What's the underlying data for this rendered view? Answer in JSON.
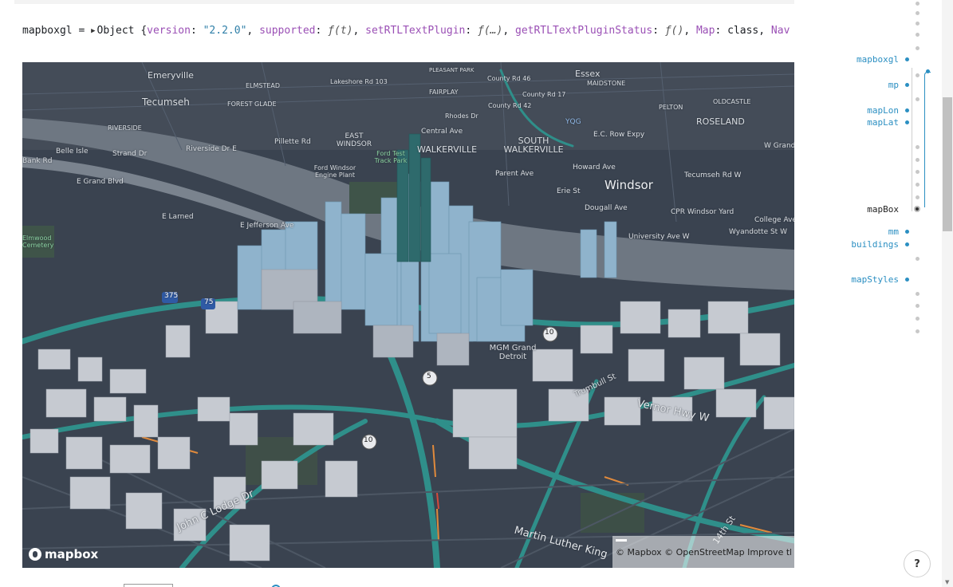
{
  "code": {
    "var_name": "mapboxgl",
    "equals": " = ",
    "type": "Object",
    "open_brace": "{",
    "tokens": [
      {
        "k": "version",
        "v": "\"2.2.0\"",
        "vk": "s"
      },
      {
        "k": "supported",
        "v": "ƒ(t)",
        "vk": "fn"
      },
      {
        "k": "setRTLTextPlugin",
        "v": "ƒ(…)",
        "vk": "fn"
      },
      {
        "k": "getRTLTextPluginStatus",
        "v": "ƒ()",
        "vk": "fn"
      },
      {
        "k": "Map",
        "v": "class",
        "vk": "p"
      },
      {
        "k": "Nav",
        "v": "",
        "vk": "p"
      }
    ]
  },
  "map": {
    "logo_text": "mapbox",
    "attribution": "© Mapbox © OpenStreetMap Improve this",
    "labels": {
      "windsor": "Windsor",
      "tecumseh": "Tecumseh",
      "emeryville": "Emeryville",
      "essex": "Essex",
      "rosebland": "ROSELAND",
      "south_walkerville": "SOUTH WALKERVILLE",
      "walkerville": "WALKERVILLE",
      "east_windsor": "EAST WINDSOR",
      "ford_test_track": "Ford Test Track Park",
      "ford_windsor": "Ford Windsor Engine Plant",
      "riverside": "RIVERSIDE",
      "riverside_dr_e": "Riverside Dr E",
      "pillette": "Pillette Rd",
      "strand": "Strand Dr",
      "belle_isle": "Belle Isle",
      "e_grand_blvd": "E Grand Blvd",
      "e_larned": "E Larned",
      "e_jefferson": "E Jefferson Ave",
      "parent_ave": "Parent Ave",
      "howard_ave": "Howard Ave",
      "erie_st": "Erie St",
      "tecumseh_rd_w": "Tecumseh Rd W",
      "cpr_windsor": "CPR Windsor Yard",
      "college_ave": "College Ave",
      "wyandotte": "Wyandotte St W",
      "university": "University Ave W",
      "dougall": "Dougall Ave",
      "mgm": "MGM Grand Detroit",
      "vernor": "Vernor Hwy W",
      "john_c_lodge": "John C Lodge Dr",
      "martin_luther": "Martin Luther King",
      "fourteenth": "14th St",
      "trumbull": "Trumbull St",
      "yqg": "YQG",
      "ec_row": "E.C. Row Expy",
      "county_rd_42": "County Rd 42",
      "county_rd_17": "County Rd 17",
      "rhodes_dr": "Rhodes Dr",
      "central_ave": "Central Ave",
      "pelton": "PELTON",
      "oldcastle": "OLDCASTLE",
      "w_grand": "W Grand B",
      "forest_glade": "FOREST GLADE",
      "elmstead": "ELMSTEAD",
      "fairplay": "FAIRPLAY",
      "maidstone": "MAIDSTONE",
      "lakeshore": "Lakeshore Rd 103",
      "county_rd_46": "County Rd 46",
      "pleasant_park": "PLEASANT PARK",
      "bank_rd": "Bank Rd",
      "elmwood": "Elmwood Cemetery",
      "shield_375": "375",
      "shield_75": "75",
      "shield_10a": "10",
      "shield_10b": "10",
      "shield_5": "5"
    }
  },
  "minimap": {
    "vars": [
      "mapboxgl",
      "mp",
      "mapLon",
      "mapLat",
      "mapBox",
      "mm",
      "buildings",
      "mapStyles"
    ],
    "active": "mapBox"
  },
  "help_label": "?"
}
